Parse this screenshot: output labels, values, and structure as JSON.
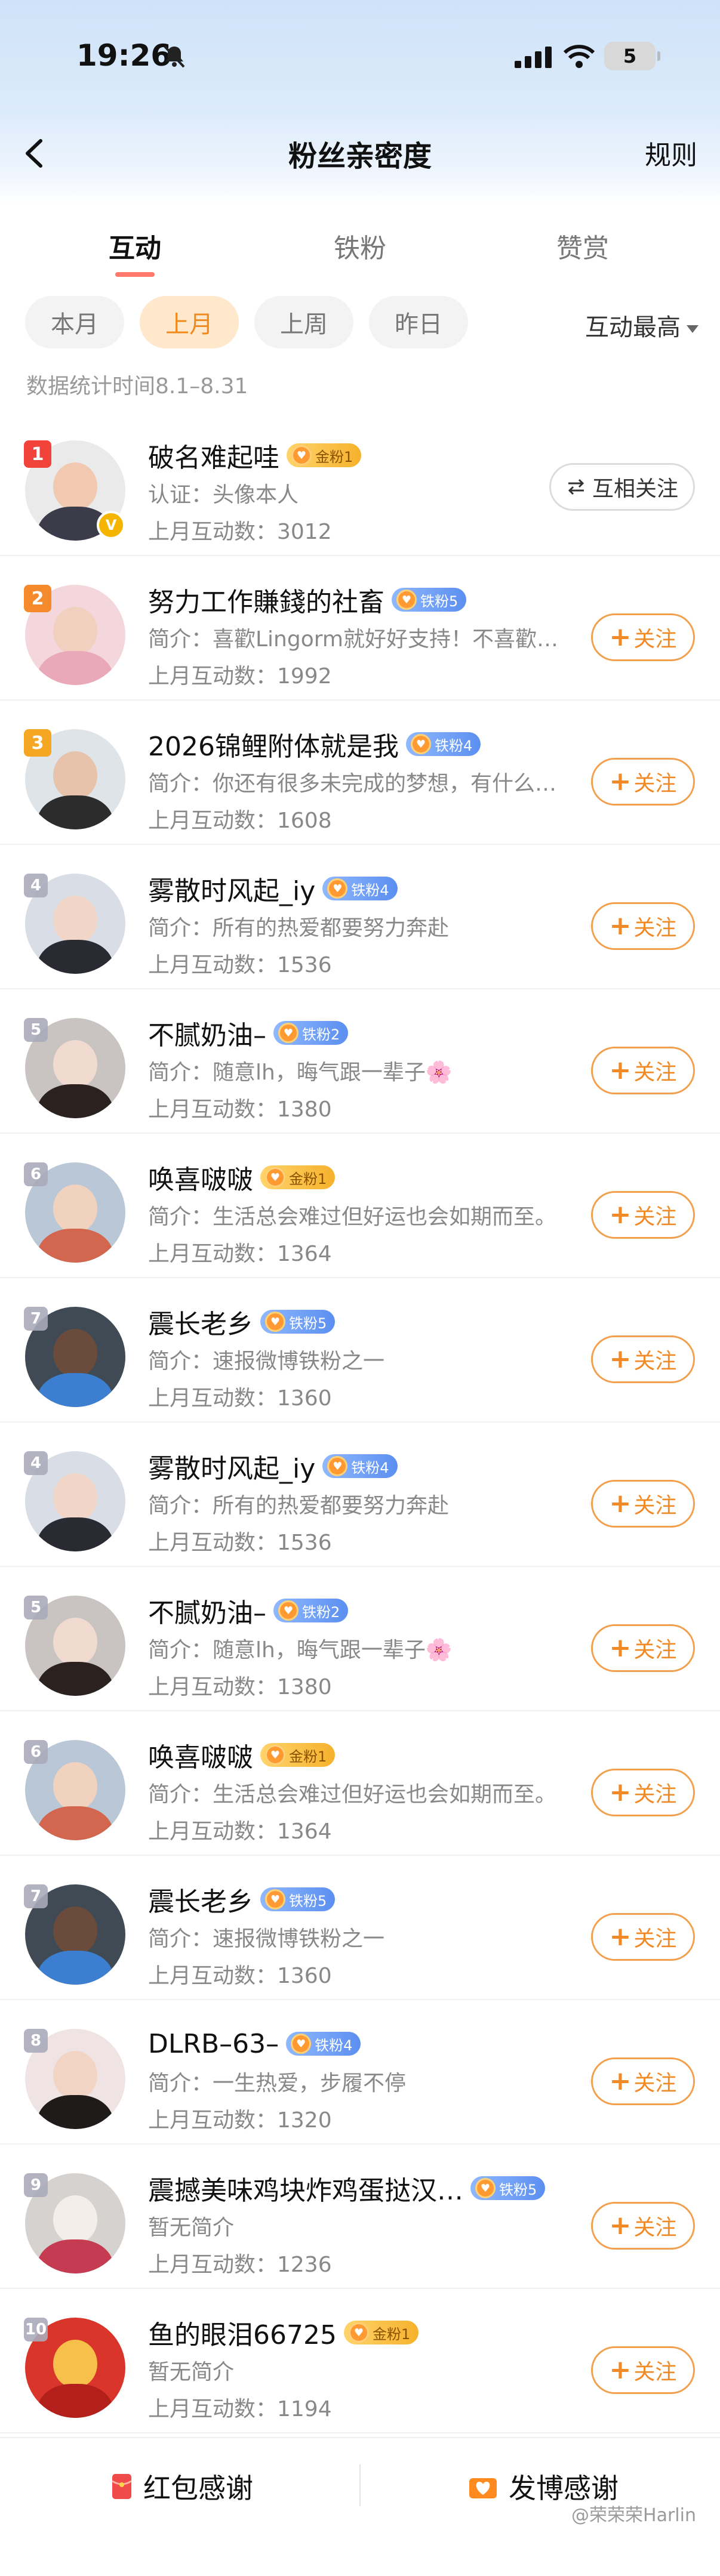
{
  "status_bar": {
    "time": "19:26",
    "battery": "5"
  },
  "nav": {
    "title": "粉丝亲密度",
    "rules": "规则"
  },
  "tabs": [
    {
      "label": "互动",
      "active": true
    },
    {
      "label": "铁粉",
      "active": false
    },
    {
      "label": "赞赏",
      "active": false
    }
  ],
  "filters": {
    "chips": [
      {
        "label": "本月",
        "active": false
      },
      {
        "label": "上月",
        "active": true
      },
      {
        "label": "上周",
        "active": false
      },
      {
        "label": "昨日",
        "active": false
      }
    ],
    "sort": "互动最高"
  },
  "stat_time": "数据统计时间8.1–8.31",
  "fans": [
    {
      "rank": "1",
      "name": "破名难起哇",
      "badge": "金粉1",
      "badge_type": "gold",
      "desc": "认证：头像本人",
      "count": "上月互动数：3012",
      "action": "互相关注",
      "action_type": "mutual",
      "avatar_bg": "#eaeaea",
      "avatar_face": "#f0c9b0",
      "avatar_body": "#3b3b4a",
      "verified": true
    },
    {
      "rank": "2",
      "name": "努力工作賺錢的社畜",
      "badge": "铁粉5",
      "badge_type": "iron",
      "desc": "简介：喜歡Lingorm就好好支持！不喜歡…",
      "count": "上月互动数：1992",
      "action": "关注",
      "action_type": "follow",
      "avatar_bg": "#f3d7dc",
      "avatar_face": "#f2d0bf",
      "avatar_body": "#e9a9b8",
      "verified": false
    },
    {
      "rank": "3",
      "name": "2026锦鲤附体就是我",
      "badge": "铁粉4",
      "badge_type": "iron",
      "desc": "简介：你还有很多未完成的梦想，有什么…",
      "count": "上月互动数：1608",
      "action": "关注",
      "action_type": "follow",
      "avatar_bg": "#dfe4e8",
      "avatar_face": "#e6c3aa",
      "avatar_body": "#2c2c2c",
      "verified": false
    },
    {
      "rank": "4",
      "name": "雾散时风起_iy",
      "badge": "铁粉4",
      "badge_type": "iron",
      "desc": "简介：所有的热爱都要努力奔赴",
      "count": "上月互动数：1536",
      "action": "关注",
      "action_type": "follow",
      "avatar_bg": "#d9dde6",
      "avatar_face": "#f1d6c8",
      "avatar_body": "#2a2a33",
      "verified": false
    },
    {
      "rank": "5",
      "name": "不腻奶油–",
      "badge": "铁粉2",
      "badge_type": "iron",
      "desc": "简介：随意lh，晦气跟一辈子🌸",
      "count": "上月互动数：1380",
      "action": "关注",
      "action_type": "follow",
      "avatar_bg": "#c9c4c2",
      "avatar_face": "#f1dbd0",
      "avatar_body": "#2b2220",
      "verified": false
    },
    {
      "rank": "6",
      "name": "唤喜啵啵",
      "badge": "金粉1",
      "badge_type": "gold",
      "desc": "简介：生活总会难过但好运也会如期而至。",
      "count": "上月互动数：1364",
      "action": "关注",
      "action_type": "follow",
      "avatar_bg": "#b9c7d6",
      "avatar_face": "#f0d2bf",
      "avatar_body": "#d2664f",
      "verified": false
    },
    {
      "rank": "7",
      "name": "震长老乡",
      "badge": "铁粉5",
      "badge_type": "iron",
      "desc": "简介：速报微博铁粉之一",
      "count": "上月互动数：1360",
      "action": "关注",
      "action_type": "follow",
      "avatar_bg": "#3f4a55",
      "avatar_face": "#6b4b3c",
      "avatar_body": "#3c7fd0",
      "verified": false
    },
    {
      "rank": "4",
      "name": "雾散时风起_iy",
      "badge": "铁粉4",
      "badge_type": "iron",
      "desc": "简介：所有的热爱都要努力奔赴",
      "count": "上月互动数：1536",
      "action": "关注",
      "action_type": "follow",
      "avatar_bg": "#d9dde6",
      "avatar_face": "#f1d6c8",
      "avatar_body": "#2a2a33",
      "verified": false
    },
    {
      "rank": "5",
      "name": "不腻奶油–",
      "badge": "铁粉2",
      "badge_type": "iron",
      "desc": "简介：随意lh，晦气跟一辈子🌸",
      "count": "上月互动数：1380",
      "action": "关注",
      "action_type": "follow",
      "avatar_bg": "#c9c4c2",
      "avatar_face": "#f1dbd0",
      "avatar_body": "#2b2220",
      "verified": false
    },
    {
      "rank": "6",
      "name": "唤喜啵啵",
      "badge": "金粉1",
      "badge_type": "gold",
      "desc": "简介：生活总会难过但好运也会如期而至。",
      "count": "上月互动数：1364",
      "action": "关注",
      "action_type": "follow",
      "avatar_bg": "#b9c7d6",
      "avatar_face": "#f0d2bf",
      "avatar_body": "#d2664f",
      "verified": false
    },
    {
      "rank": "7",
      "name": "震长老乡",
      "badge": "铁粉5",
      "badge_type": "iron",
      "desc": "简介：速报微博铁粉之一",
      "count": "上月互动数：1360",
      "action": "关注",
      "action_type": "follow",
      "avatar_bg": "#3f4a55",
      "avatar_face": "#6b4b3c",
      "avatar_body": "#3c7fd0",
      "verified": false
    },
    {
      "rank": "8",
      "name": "DLRB–63–",
      "badge": "铁粉4",
      "badge_type": "iron",
      "desc": "简介：一生热爱，步履不停",
      "count": "上月互动数：1320",
      "action": "关注",
      "action_type": "follow",
      "avatar_bg": "#efe3e3",
      "avatar_face": "#f2d4c5",
      "avatar_body": "#1f1b1b",
      "verified": false
    },
    {
      "rank": "9",
      "name": "震撼美味鸡块炸鸡蛋挞汉…",
      "badge": "铁粉5",
      "badge_type": "iron",
      "desc": "暂无简介",
      "count": "上月互动数：1236",
      "action": "关注",
      "action_type": "follow",
      "avatar_bg": "#d6d2cf",
      "avatar_face": "#f5eee8",
      "avatar_body": "#c43b52",
      "verified": false
    },
    {
      "rank": "10",
      "name": "鱼的眼泪66725",
      "badge": "金粉1",
      "badge_type": "gold",
      "desc": "暂无简介",
      "count": "上月互动数：1194",
      "action": "关注",
      "action_type": "follow",
      "avatar_bg": "#d9352b",
      "avatar_face": "#f7c04a",
      "avatar_body": "#b31f1a",
      "verified": false
    }
  ],
  "bottom_bar": {
    "red_packet": "红包感谢",
    "post_thanks": "发博感谢",
    "watermark": "@荣荣荣Harlin"
  },
  "colors": {
    "accent": "#ef8a26",
    "tab_indicator": "#ff7a6c",
    "rank1": "#f2433a",
    "rank2": "#f58a2c",
    "rank3": "#f5a623"
  }
}
